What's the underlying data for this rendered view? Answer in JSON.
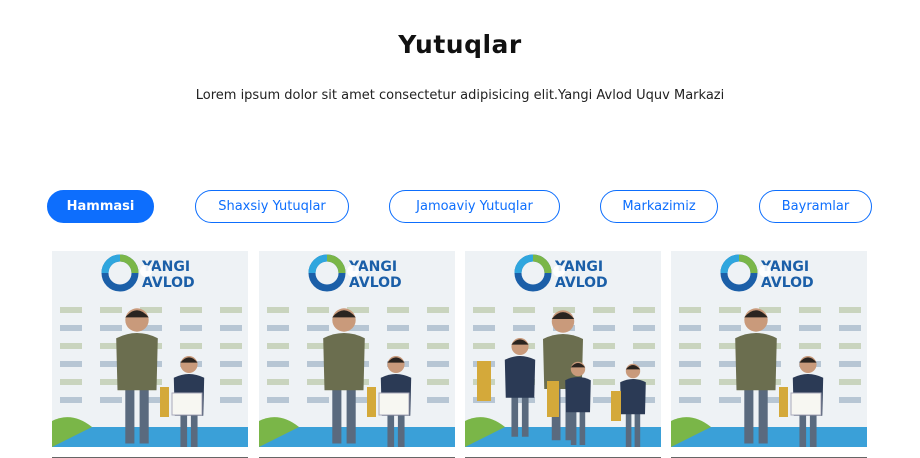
{
  "header": {
    "title": "Yutuqlar",
    "subtitle": "Lorem ipsum dolor sit amet consectetur adipisicing elit.Yangi Avlod Uquv Markazi"
  },
  "filters": [
    {
      "label": "Hammasi",
      "active": true
    },
    {
      "label": "Shaxsiy Yutuqlar",
      "active": false
    },
    {
      "label": "Jamoaviy Yutuqlar",
      "active": false
    },
    {
      "label": "Markazimiz",
      "active": false
    },
    {
      "label": "Bayramlar",
      "active": false
    }
  ],
  "photos": [
    {
      "logo_line1": "YANGI",
      "logo_line2": "AVLOD",
      "kids": 1
    },
    {
      "logo_line1": "YANGI",
      "logo_line2": "AVLOD",
      "kids": 1
    },
    {
      "logo_line1": "YANGI",
      "logo_line2": "AVLOD",
      "kids": 3
    },
    {
      "logo_line1": "YANGI",
      "logo_line2": "AVLOD",
      "kids": 1
    }
  ],
  "colors": {
    "accent": "#0d6efd",
    "logo_blue": "#1b5fa8",
    "logo_green": "#7ab648"
  }
}
